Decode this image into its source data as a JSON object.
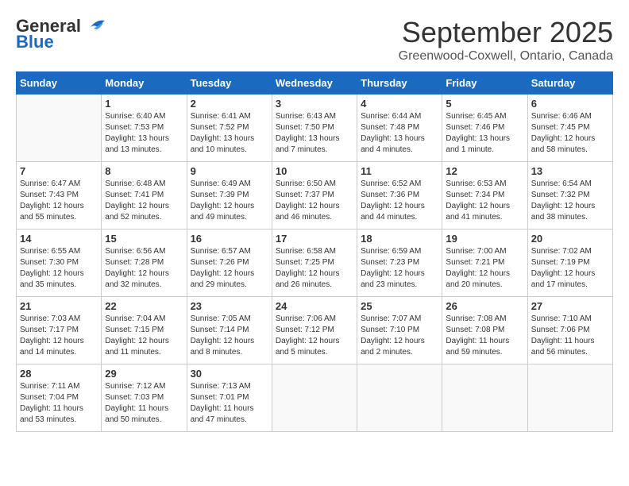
{
  "header": {
    "logo_line1": "General",
    "logo_line2": "Blue",
    "month": "September 2025",
    "location": "Greenwood-Coxwell, Ontario, Canada"
  },
  "weekdays": [
    "Sunday",
    "Monday",
    "Tuesday",
    "Wednesday",
    "Thursday",
    "Friday",
    "Saturday"
  ],
  "weeks": [
    [
      {
        "day": "",
        "info": ""
      },
      {
        "day": "1",
        "info": "Sunrise: 6:40 AM\nSunset: 7:53 PM\nDaylight: 13 hours\nand 13 minutes."
      },
      {
        "day": "2",
        "info": "Sunrise: 6:41 AM\nSunset: 7:52 PM\nDaylight: 13 hours\nand 10 minutes."
      },
      {
        "day": "3",
        "info": "Sunrise: 6:43 AM\nSunset: 7:50 PM\nDaylight: 13 hours\nand 7 minutes."
      },
      {
        "day": "4",
        "info": "Sunrise: 6:44 AM\nSunset: 7:48 PM\nDaylight: 13 hours\nand 4 minutes."
      },
      {
        "day": "5",
        "info": "Sunrise: 6:45 AM\nSunset: 7:46 PM\nDaylight: 13 hours\nand 1 minute."
      },
      {
        "day": "6",
        "info": "Sunrise: 6:46 AM\nSunset: 7:45 PM\nDaylight: 12 hours\nand 58 minutes."
      }
    ],
    [
      {
        "day": "7",
        "info": "Sunrise: 6:47 AM\nSunset: 7:43 PM\nDaylight: 12 hours\nand 55 minutes."
      },
      {
        "day": "8",
        "info": "Sunrise: 6:48 AM\nSunset: 7:41 PM\nDaylight: 12 hours\nand 52 minutes."
      },
      {
        "day": "9",
        "info": "Sunrise: 6:49 AM\nSunset: 7:39 PM\nDaylight: 12 hours\nand 49 minutes."
      },
      {
        "day": "10",
        "info": "Sunrise: 6:50 AM\nSunset: 7:37 PM\nDaylight: 12 hours\nand 46 minutes."
      },
      {
        "day": "11",
        "info": "Sunrise: 6:52 AM\nSunset: 7:36 PM\nDaylight: 12 hours\nand 44 minutes."
      },
      {
        "day": "12",
        "info": "Sunrise: 6:53 AM\nSunset: 7:34 PM\nDaylight: 12 hours\nand 41 minutes."
      },
      {
        "day": "13",
        "info": "Sunrise: 6:54 AM\nSunset: 7:32 PM\nDaylight: 12 hours\nand 38 minutes."
      }
    ],
    [
      {
        "day": "14",
        "info": "Sunrise: 6:55 AM\nSunset: 7:30 PM\nDaylight: 12 hours\nand 35 minutes."
      },
      {
        "day": "15",
        "info": "Sunrise: 6:56 AM\nSunset: 7:28 PM\nDaylight: 12 hours\nand 32 minutes."
      },
      {
        "day": "16",
        "info": "Sunrise: 6:57 AM\nSunset: 7:26 PM\nDaylight: 12 hours\nand 29 minutes."
      },
      {
        "day": "17",
        "info": "Sunrise: 6:58 AM\nSunset: 7:25 PM\nDaylight: 12 hours\nand 26 minutes."
      },
      {
        "day": "18",
        "info": "Sunrise: 6:59 AM\nSunset: 7:23 PM\nDaylight: 12 hours\nand 23 minutes."
      },
      {
        "day": "19",
        "info": "Sunrise: 7:00 AM\nSunset: 7:21 PM\nDaylight: 12 hours\nand 20 minutes."
      },
      {
        "day": "20",
        "info": "Sunrise: 7:02 AM\nSunset: 7:19 PM\nDaylight: 12 hours\nand 17 minutes."
      }
    ],
    [
      {
        "day": "21",
        "info": "Sunrise: 7:03 AM\nSunset: 7:17 PM\nDaylight: 12 hours\nand 14 minutes."
      },
      {
        "day": "22",
        "info": "Sunrise: 7:04 AM\nSunset: 7:15 PM\nDaylight: 12 hours\nand 11 minutes."
      },
      {
        "day": "23",
        "info": "Sunrise: 7:05 AM\nSunset: 7:14 PM\nDaylight: 12 hours\nand 8 minutes."
      },
      {
        "day": "24",
        "info": "Sunrise: 7:06 AM\nSunset: 7:12 PM\nDaylight: 12 hours\nand 5 minutes."
      },
      {
        "day": "25",
        "info": "Sunrise: 7:07 AM\nSunset: 7:10 PM\nDaylight: 12 hours\nand 2 minutes."
      },
      {
        "day": "26",
        "info": "Sunrise: 7:08 AM\nSunset: 7:08 PM\nDaylight: 11 hours\nand 59 minutes."
      },
      {
        "day": "27",
        "info": "Sunrise: 7:10 AM\nSunset: 7:06 PM\nDaylight: 11 hours\nand 56 minutes."
      }
    ],
    [
      {
        "day": "28",
        "info": "Sunrise: 7:11 AM\nSunset: 7:04 PM\nDaylight: 11 hours\nand 53 minutes."
      },
      {
        "day": "29",
        "info": "Sunrise: 7:12 AM\nSunset: 7:03 PM\nDaylight: 11 hours\nand 50 minutes."
      },
      {
        "day": "30",
        "info": "Sunrise: 7:13 AM\nSunset: 7:01 PM\nDaylight: 11 hours\nand 47 minutes."
      },
      {
        "day": "",
        "info": ""
      },
      {
        "day": "",
        "info": ""
      },
      {
        "day": "",
        "info": ""
      },
      {
        "day": "",
        "info": ""
      }
    ]
  ]
}
